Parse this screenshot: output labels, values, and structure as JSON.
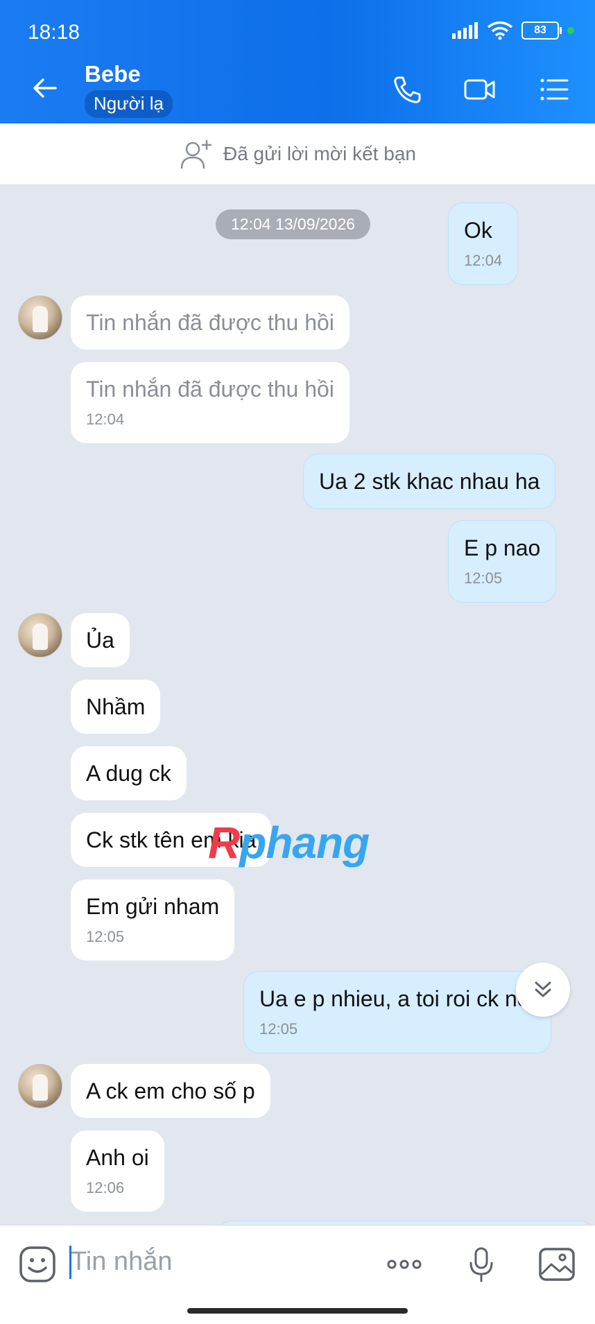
{
  "status_bar": {
    "time": "18:18",
    "battery": "83"
  },
  "header": {
    "contact_name": "Bebe",
    "contact_tag": "Người lạ"
  },
  "friend_request": {
    "text": "Đã gửi lời mời kết bạn"
  },
  "chat": {
    "date_separator": "12:04 13/09/2026",
    "messages": [
      {
        "dir": "out",
        "text": "Ok",
        "time": "12:04"
      },
      {
        "dir": "in",
        "text": "Tin nhắn đã được thu hồi"
      },
      {
        "dir": "in",
        "text": "Tin nhắn đã được thu hồi",
        "time": "12:04"
      },
      {
        "dir": "out",
        "text": "Ua 2 stk khac nhau ha"
      },
      {
        "dir": "out",
        "text": "E p nao",
        "time": "12:05"
      },
      {
        "dir": "in",
        "text": "Ủa"
      },
      {
        "dir": "in",
        "text": "Nhầm"
      },
      {
        "dir": "in",
        "text": "A dug ck"
      },
      {
        "dir": "in",
        "text": "Ck stk tên em kia"
      },
      {
        "dir": "in",
        "text": "Em gửi nham",
        "time": "12:05"
      },
      {
        "dir": "out",
        "text": "Ua e p nhieu, a toi roi ck not",
        "time": "12:05"
      },
      {
        "dir": "in",
        "text": "A ck em cho số p"
      },
      {
        "dir": "in",
        "text": "Anh oi",
        "time": "12:06"
      }
    ],
    "watermark": {
      "first": "R",
      "rest": "phang"
    }
  },
  "input": {
    "placeholder": "Tin nhắn"
  },
  "icons": {
    "back": "arrow-left-icon",
    "call": "phone-icon",
    "video": "video-camera-icon",
    "menu": "list-menu-icon",
    "add_friend": "person-add-icon",
    "emoji": "emoji-icon",
    "more": "more-dots-icon",
    "voice": "microphone-icon",
    "image": "image-icon",
    "scroll_down": "double-chevron-down-icon"
  },
  "colors": {
    "header": "#0d6fe9",
    "outgoing_bubble": "#d6eefe",
    "incoming_bubble": "#ffffff",
    "chat_bg": "#e2e6ef"
  }
}
